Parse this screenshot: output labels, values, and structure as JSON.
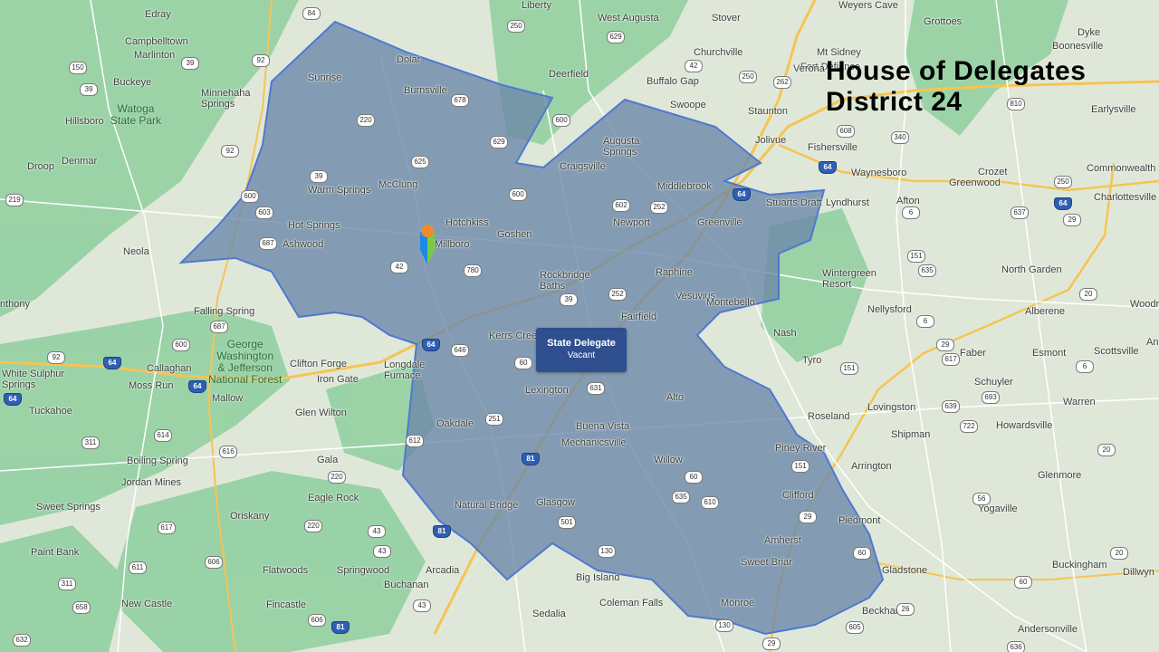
{
  "title": {
    "line1": "House of Delegates",
    "line2": "District 24"
  },
  "info_card": {
    "role": "State Delegate",
    "status": "Vacant"
  },
  "colors": {
    "district_fill": "#6a86a8",
    "district_border": "#4f78d0",
    "forest": "#8fcf9f",
    "land": "#dfe8d8",
    "road_major": "#f6c453",
    "road_minor": "#ffffff",
    "card_bg": "#2f4f8f",
    "pin_orange": "#f08a2c",
    "pin_blue": "#1e88e5",
    "pin_green": "#7ac943"
  },
  "places": [
    {
      "id": "edray",
      "name": "Edray"
    },
    {
      "id": "liberty",
      "name": "Liberty"
    },
    {
      "id": "west-augusta",
      "name": "West Augusta"
    },
    {
      "id": "stover",
      "name": "Stover"
    },
    {
      "id": "weyers-cave",
      "name": "Weyers Cave"
    },
    {
      "id": "grottoes",
      "name": "Grottoes"
    },
    {
      "id": "campbelltown",
      "name": "Campbelltown"
    },
    {
      "id": "marlinton",
      "name": "Marlinton"
    },
    {
      "id": "churchville",
      "name": "Churchville"
    },
    {
      "id": "mt-sidney",
      "name": "Mt Sidney"
    },
    {
      "id": "fort-defiance",
      "name": "Fort Defiance"
    },
    {
      "id": "dyke",
      "name": "Dyke"
    },
    {
      "id": "boonesville",
      "name": "Boonesville"
    },
    {
      "id": "dolar",
      "name": "Dolar"
    },
    {
      "id": "sunrise",
      "name": "Sunrise"
    },
    {
      "id": "verona",
      "name": "Verona"
    },
    {
      "id": "buckeye",
      "name": "Buckeye"
    },
    {
      "id": "minnehaha-springs",
      "name": "Minnehaha\nSprings"
    },
    {
      "id": "burnsville",
      "name": "Burnsville"
    },
    {
      "id": "deerfield",
      "name": "Deerfield"
    },
    {
      "id": "buffalo-gap",
      "name": "Buffalo Gap"
    },
    {
      "id": "hillsboro",
      "name": "Hillsboro"
    },
    {
      "id": "swoope",
      "name": "Swoope"
    },
    {
      "id": "staunton",
      "name": "Staunton"
    },
    {
      "id": "earlysville",
      "name": "Earlysville"
    },
    {
      "id": "augusta-springs",
      "name": "Augusta\nSprings"
    },
    {
      "id": "jolivue",
      "name": "Jolivue"
    },
    {
      "id": "fishersville",
      "name": "Fishersville"
    },
    {
      "id": "droop",
      "name": "Droop"
    },
    {
      "id": "denmar",
      "name": "Denmar"
    },
    {
      "id": "craigsville",
      "name": "Craigsville"
    },
    {
      "id": "waynesboro",
      "name": "Waynesboro"
    },
    {
      "id": "crozet",
      "name": "Crozet"
    },
    {
      "id": "commonwealth",
      "name": "Commonwealth"
    },
    {
      "id": "mcclung",
      "name": "McClung"
    },
    {
      "id": "warm-springs",
      "name": "Warm Springs"
    },
    {
      "id": "middlebrook",
      "name": "Middlebrook"
    },
    {
      "id": "greenwood",
      "name": "Greenwood"
    },
    {
      "id": "charlottesville",
      "name": "Charlottesville"
    },
    {
      "id": "stuarts-draft",
      "name": "Stuarts Draft"
    },
    {
      "id": "lyndhurst",
      "name": "Lyndhurst"
    },
    {
      "id": "afton",
      "name": "Afton"
    },
    {
      "id": "hotchkiss",
      "name": "Hotchkiss"
    },
    {
      "id": "hot-springs",
      "name": "Hot Springs"
    },
    {
      "id": "newport",
      "name": "Newport"
    },
    {
      "id": "greenville",
      "name": "Greenville"
    },
    {
      "id": "goshen",
      "name": "Goshen"
    },
    {
      "id": "ashwood",
      "name": "Ashwood"
    },
    {
      "id": "millboro",
      "name": "Millboro"
    },
    {
      "id": "neola",
      "name": "Neola"
    },
    {
      "id": "raphine",
      "name": "Raphine"
    },
    {
      "id": "north-garden",
      "name": "North Garden"
    },
    {
      "id": "rockbridge-baths",
      "name": "Rockbridge\nBaths"
    },
    {
      "id": "wintergreen-resort",
      "name": "Wintergreen\nResort"
    },
    {
      "id": "vesuvius",
      "name": "Vesuvius"
    },
    {
      "id": "anthony",
      "name": "nthony"
    },
    {
      "id": "falling-spring",
      "name": "Falling Spring"
    },
    {
      "id": "nellysford",
      "name": "Nellysford"
    },
    {
      "id": "alberene",
      "name": "Alberene"
    },
    {
      "id": "woodr",
      "name": "Woodr"
    },
    {
      "id": "fairfield",
      "name": "Fairfield"
    },
    {
      "id": "montebello",
      "name": "Montebello"
    },
    {
      "id": "nash",
      "name": "Nash"
    },
    {
      "id": "kerrs-creek",
      "name": "Kerrs Cree"
    },
    {
      "id": "faber",
      "name": "Faber"
    },
    {
      "id": "esmont",
      "name": "Esmont"
    },
    {
      "id": "antr",
      "name": "Ant"
    },
    {
      "id": "clifton-forge",
      "name": "Clifton Forge"
    },
    {
      "id": "longdale-furnace",
      "name": "Longdale\nFurnace"
    },
    {
      "id": "tyro",
      "name": "Tyro"
    },
    {
      "id": "white-sulphur-springs",
      "name": "White Sulphur\nSprings"
    },
    {
      "id": "callaghan",
      "name": "Callaghan"
    },
    {
      "id": "iron-gate",
      "name": "Iron Gate"
    },
    {
      "id": "scottsville",
      "name": "Scottsville"
    },
    {
      "id": "moss-run",
      "name": "Moss Run"
    },
    {
      "id": "mallow",
      "name": "Mallow"
    },
    {
      "id": "lexington",
      "name": "Lexington"
    },
    {
      "id": "alto",
      "name": "Alto"
    },
    {
      "id": "schuyler",
      "name": "Schuyler"
    },
    {
      "id": "warren",
      "name": "Warren"
    },
    {
      "id": "lovingston",
      "name": "Lovingston"
    },
    {
      "id": "tuckahoe",
      "name": "Tuckahoe"
    },
    {
      "id": "glen-wilton",
      "name": "Glen Wilton"
    },
    {
      "id": "roseland",
      "name": "Roseland"
    },
    {
      "id": "oakdale",
      "name": "Oakdale"
    },
    {
      "id": "buena-vista",
      "name": "Buena Vista"
    },
    {
      "id": "howardsville",
      "name": "Howardsville"
    },
    {
      "id": "shipman",
      "name": "Shipman"
    },
    {
      "id": "mechanicsville",
      "name": "Mechanicsville"
    },
    {
      "id": "piney-river",
      "name": "Piney River"
    },
    {
      "id": "boiling-spring",
      "name": "Boiling Spring"
    },
    {
      "id": "gala",
      "name": "Gala"
    },
    {
      "id": "willow",
      "name": "Willow"
    },
    {
      "id": "arrington",
      "name": "Arrington"
    },
    {
      "id": "jordan-mines",
      "name": "Jordan Mines"
    },
    {
      "id": "glenmore",
      "name": "Glenmore"
    },
    {
      "id": "eagle-rock",
      "name": "Eagle Rock"
    },
    {
      "id": "clifford",
      "name": "Clifford"
    },
    {
      "id": "natural-bridge",
      "name": "Natural Bridge"
    },
    {
      "id": "glasgow",
      "name": "Glasgow"
    },
    {
      "id": "yogaville",
      "name": "Yogaville"
    },
    {
      "id": "sweet-springs",
      "name": "Sweet Springs"
    },
    {
      "id": "oriskany",
      "name": "Oriskany"
    },
    {
      "id": "piedmont",
      "name": "Piedmont"
    },
    {
      "id": "amherst",
      "name": "Amherst"
    },
    {
      "id": "paint-bank",
      "name": "Paint Bank"
    },
    {
      "id": "sweet-briar",
      "name": "Sweet Briar"
    },
    {
      "id": "buckingham",
      "name": "Buckingham"
    },
    {
      "id": "flatwoods",
      "name": "Flatwoods"
    },
    {
      "id": "springwood",
      "name": "Springwood"
    },
    {
      "id": "arcadia",
      "name": "Arcadia"
    },
    {
      "id": "gladstone",
      "name": "Gladstone"
    },
    {
      "id": "dillwyn",
      "name": "Dillwyn"
    },
    {
      "id": "big-island",
      "name": "Big Island"
    },
    {
      "id": "buchanan",
      "name": "Buchanan"
    },
    {
      "id": "new-castle",
      "name": "New Castle"
    },
    {
      "id": "fincastle",
      "name": "Fincastle"
    },
    {
      "id": "coleman-falls",
      "name": "Coleman Falls"
    },
    {
      "id": "monroe",
      "name": "Monroe"
    },
    {
      "id": "beckham",
      "name": "Beckham"
    },
    {
      "id": "sedalia",
      "name": "Sedalia"
    },
    {
      "id": "andersonville",
      "name": "Andersonville"
    },
    {
      "id": "watoga-state-park",
      "name": "Watoga\nState Park",
      "forest": true
    },
    {
      "id": "george-washington-jefferson-nf",
      "name": "George\nWashington\n& Jefferson\nNational Forest",
      "forest": true
    }
  ],
  "route_shields": [
    {
      "id": "r84",
      "label": "84"
    },
    {
      "id": "r250a",
      "label": "250"
    },
    {
      "id": "r629",
      "label": "629"
    },
    {
      "id": "r92a",
      "label": "92"
    },
    {
      "id": "r150",
      "label": "150"
    },
    {
      "id": "r39a",
      "label": "39"
    },
    {
      "id": "r42a",
      "label": "42"
    },
    {
      "id": "r250b",
      "label": "250"
    },
    {
      "id": "r262",
      "label": "262"
    },
    {
      "id": "r39b",
      "label": "39"
    },
    {
      "id": "r220a",
      "label": "220"
    },
    {
      "id": "r678",
      "label": "678"
    },
    {
      "id": "r810",
      "label": "810"
    },
    {
      "id": "r600a",
      "label": "600"
    },
    {
      "id": "r629b",
      "label": "629"
    },
    {
      "id": "r608",
      "label": "608"
    },
    {
      "id": "r340",
      "label": "340"
    },
    {
      "id": "r92b",
      "label": "92"
    },
    {
      "id": "r625",
      "label": "625"
    },
    {
      "id": "i64a",
      "label": "64",
      "interstate": true
    },
    {
      "id": "r39c",
      "label": "39"
    },
    {
      "id": "r250c",
      "label": "250"
    },
    {
      "id": "r219",
      "label": "219"
    },
    {
      "id": "r600b",
      "label": "600"
    },
    {
      "id": "r603",
      "label": "603"
    },
    {
      "id": "r600c",
      "label": "600"
    },
    {
      "id": "r602",
      "label": "602"
    },
    {
      "id": "r252a",
      "label": "252"
    },
    {
      "id": "i64b",
      "label": "64",
      "interstate": true
    },
    {
      "id": "i64c",
      "label": "64",
      "interstate": true
    },
    {
      "id": "r6a",
      "label": "6"
    },
    {
      "id": "r637",
      "label": "637"
    },
    {
      "id": "r29a",
      "label": "29"
    },
    {
      "id": "r687a",
      "label": "687"
    },
    {
      "id": "r42b",
      "label": "42"
    },
    {
      "id": "r780",
      "label": "780"
    },
    {
      "id": "r39d",
      "label": "39"
    },
    {
      "id": "r252b",
      "label": "252"
    },
    {
      "id": "r151a",
      "label": "151"
    },
    {
      "id": "r635",
      "label": "635"
    },
    {
      "id": "r20a",
      "label": "20"
    },
    {
      "id": "r687b",
      "label": "687"
    },
    {
      "id": "r6b",
      "label": "6"
    },
    {
      "id": "r92c",
      "label": "92"
    },
    {
      "id": "r600d",
      "label": "600"
    },
    {
      "id": "i64d",
      "label": "64",
      "interstate": true
    },
    {
      "id": "r646",
      "label": "646"
    },
    {
      "id": "i64e",
      "label": "64",
      "interstate": true
    },
    {
      "id": "r60a",
      "label": "60"
    },
    {
      "id": "r29b",
      "label": "29"
    },
    {
      "id": "r617a",
      "label": "617"
    },
    {
      "id": "r151b",
      "label": "151"
    },
    {
      "id": "r6c",
      "label": "6"
    },
    {
      "id": "i64f",
      "label": "64",
      "interstate": true
    },
    {
      "id": "i64g",
      "label": "64",
      "interstate": true
    },
    {
      "id": "r631",
      "label": "631"
    },
    {
      "id": "r693",
      "label": "693"
    },
    {
      "id": "r639",
      "label": "639"
    },
    {
      "id": "r614",
      "label": "614"
    },
    {
      "id": "r251",
      "label": "251"
    },
    {
      "id": "r722",
      "label": "722"
    },
    {
      "id": "r311a",
      "label": "311"
    },
    {
      "id": "r612",
      "label": "612"
    },
    {
      "id": "r616",
      "label": "616"
    },
    {
      "id": "r20b",
      "label": "20"
    },
    {
      "id": "i81a",
      "label": "81",
      "interstate": true
    },
    {
      "id": "r151c",
      "label": "151"
    },
    {
      "id": "r220b",
      "label": "220"
    },
    {
      "id": "r60b",
      "label": "60"
    },
    {
      "id": "r635b",
      "label": "635"
    },
    {
      "id": "r610",
      "label": "610"
    },
    {
      "id": "r56",
      "label": "56"
    },
    {
      "id": "r29c",
      "label": "29"
    },
    {
      "id": "r501",
      "label": "501"
    },
    {
      "id": "r220c",
      "label": "220"
    },
    {
      "id": "r617b",
      "label": "617"
    },
    {
      "id": "r43a",
      "label": "43"
    },
    {
      "id": "i81b",
      "label": "81",
      "interstate": true
    },
    {
      "id": "r60c",
      "label": "60"
    },
    {
      "id": "r20c",
      "label": "20"
    },
    {
      "id": "r611",
      "label": "611"
    },
    {
      "id": "r606",
      "label": "606"
    },
    {
      "id": "r43b",
      "label": "43"
    },
    {
      "id": "r130a",
      "label": "130"
    },
    {
      "id": "r311b",
      "label": "311"
    },
    {
      "id": "r60d",
      "label": "60"
    },
    {
      "id": "r43c",
      "label": "43"
    },
    {
      "id": "r26",
      "label": "26"
    },
    {
      "id": "r658",
      "label": "658"
    },
    {
      "id": "r606b",
      "label": "606"
    },
    {
      "id": "r130b",
      "label": "130"
    },
    {
      "id": "r605",
      "label": "605"
    },
    {
      "id": "r632",
      "label": "632"
    },
    {
      "id": "i81c",
      "label": "81",
      "interstate": true
    },
    {
      "id": "r29d",
      "label": "29"
    },
    {
      "id": "r636",
      "label": "636"
    }
  ]
}
